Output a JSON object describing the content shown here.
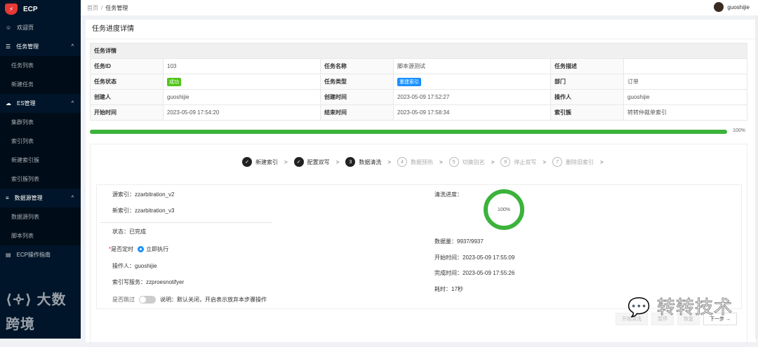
{
  "app": {
    "name": "ECP",
    "logo_text": "Z"
  },
  "sidebar": {
    "items": [
      {
        "label": "欢迎页",
        "icon": "smile-icon"
      },
      {
        "label": "任务管理",
        "icon": "list-icon",
        "children": [
          "任务列表",
          "新建任务"
        ]
      },
      {
        "label": "ES管理",
        "icon": "cloud-icon",
        "children": [
          "集群列表",
          "索引列表",
          "新建索引簇",
          "索引簇列表"
        ]
      },
      {
        "label": "数据源管理",
        "icon": "database-icon",
        "children": [
          "数据源列表",
          "脚本列表"
        ]
      },
      {
        "label": "ECP操作指南",
        "icon": "book-icon"
      }
    ],
    "watermark": "大数跨境"
  },
  "header": {
    "breadcrumb": [
      "首页",
      "任务管理"
    ],
    "separator": "/",
    "user": "guoshijie"
  },
  "page": {
    "title": "任务进度详情"
  },
  "details": {
    "heading": "任务详情",
    "rows": [
      [
        {
          "k": "任务ID",
          "v": "103"
        },
        {
          "k": "任务名称",
          "v": "脚本源测试"
        },
        {
          "k": "任务描述",
          "v": ""
        }
      ],
      [
        {
          "k": "任务状态",
          "v": "成功",
          "tag": "#52c41a"
        },
        {
          "k": "任务类型",
          "v": "重建索引",
          "tag": "#1890ff"
        },
        {
          "k": "部门",
          "v": "订单"
        }
      ],
      [
        {
          "k": "创建人",
          "v": "guoshijie"
        },
        {
          "k": "创建时间",
          "v": "2023-05-09 17:52:27"
        },
        {
          "k": "操作人",
          "v": "guoshijie"
        }
      ],
      [
        {
          "k": "开始时间",
          "v": "2023-05-09 17:54:20"
        },
        {
          "k": "结束时间",
          "v": "2023-05-09 17:58:34"
        },
        {
          "k": "索引簇",
          "v": "转转仲裁单索引"
        }
      ]
    ]
  },
  "progress": {
    "percent": 100,
    "label": "100%"
  },
  "steps": [
    {
      "num": "1",
      "label": "新建索引",
      "state": "done"
    },
    {
      "num": "2",
      "label": "配置双写",
      "state": "done"
    },
    {
      "num": "3",
      "label": "数据清洗",
      "state": "current"
    },
    {
      "num": "4",
      "label": "数据预热",
      "state": "todo"
    },
    {
      "num": "5",
      "label": "切换别名",
      "state": "todo"
    },
    {
      "num": "6",
      "label": "停止双写",
      "state": "todo"
    },
    {
      "num": "7",
      "label": "删除旧索引",
      "state": "todo"
    }
  ],
  "clean": {
    "source": "源索引：zzarbitration_v2",
    "target": "新索引：zzarbitration_v3",
    "status": "状态：已完成",
    "schedule_label": "是否定时",
    "schedule_required": "*",
    "schedule_option": "立即执行",
    "operator": "操作人：guoshijie",
    "writer": "索引写服务：zzproesnotifyer",
    "skip_label": "是否跳过",
    "skip_note": "说明：默认关闭，开启表示放弃本步骤操作",
    "skip_on": false,
    "progress_label": "清洗进度：",
    "progress_percent": 100,
    "progress_text": "100%",
    "count": "数据量：9937/9937",
    "start": "开始时间：2023-05-09 17:55:09",
    "end": "完成时间：2023-05-09 17:55:26",
    "duration": "耗时：17秒"
  },
  "buttons": {
    "start": "开始清洗",
    "pause": "暂停",
    "resume": "恢复",
    "next": "下一步",
    "next_icon": "→"
  },
  "watermark": "转转技术"
}
